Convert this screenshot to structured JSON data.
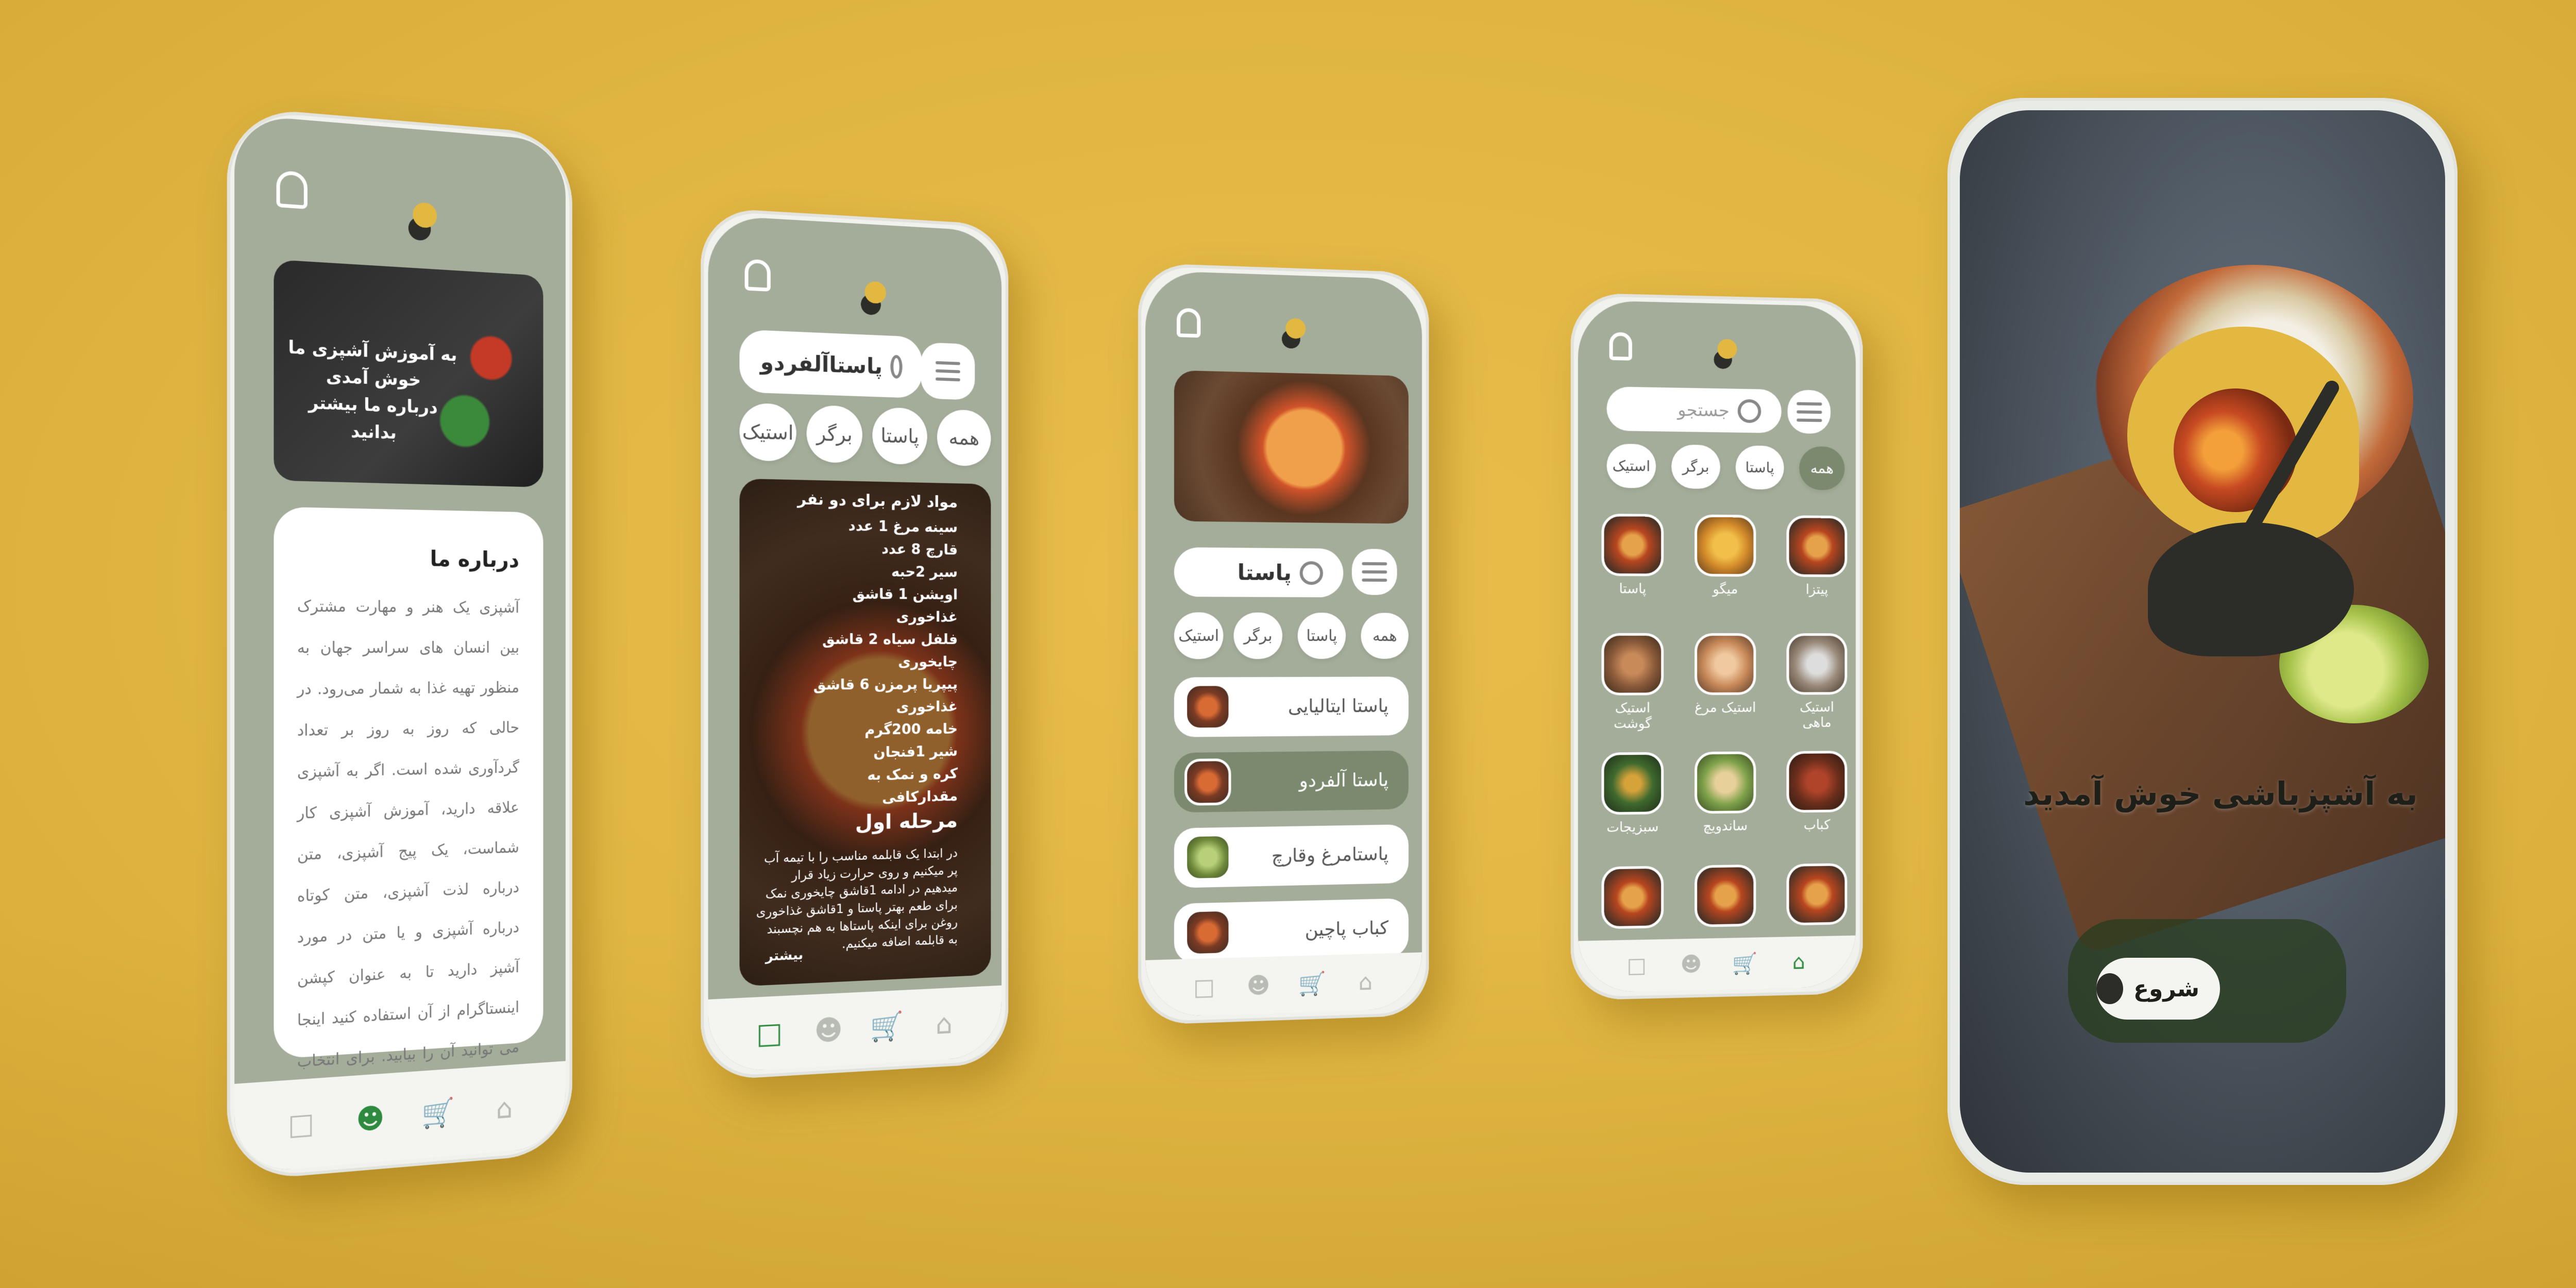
{
  "brand": {
    "yellow": "#e2b841",
    "sage": "#a4ad9a",
    "green_active": "#2d8a3e",
    "dark": "#2c2c28"
  },
  "phone_about": {
    "banner_text": "به آموزش آشپزی ما خوش آمدی\nدرباره ما بیشتر بدانید",
    "about_title": "درباره ما",
    "about_body": "آشپزی یک هنر و مهارت مشترک بین انسان های سراسر جهان به منظور تهیه غذا به شمار می‌رود. در حالی که روز به روز بر تعداد گردآوری شده است. اگر به آشپزی علاقه دارید، آموزش آشپزی کار شماست، یک پیج آشپزی، متن درباره لذت آشپزی، متن کوتاه درباره آشپزی و یا متن در مورد آشپز دارید تا به عنوان کپشن اینستاگرام از آن استفاده کنید اینجا می توانید آن را بیابید. برای انتخاب اسم برای پیج آشپزی کلیک کنید.",
    "nav_icons": [
      "bookmark-icon",
      "people-icon",
      "cart-icon",
      "home-icon"
    ],
    "active_nav": 1
  },
  "phone_recipe": {
    "search_value": "پاستاآلفردو",
    "filters": [
      "همه",
      "پاستا",
      "برگر",
      "استیک"
    ],
    "ingredients_title": "مواد لازم برای دو نفر",
    "ingredients": [
      "سینه مرغ 1 عدد",
      "قارچ 8 عدد",
      "سیر 2حبه",
      "اویشن 1 قاشق",
      "غذاخوری",
      "فلفل سیاه 2 قاشق",
      "چایخوری",
      "پیپریا پرمزن 6 قاشق",
      "غذاخوری",
      "خامه 200گرم",
      "شیر 1فنجان",
      "کره و نمک به مقدارکافی"
    ],
    "step_title": "مرحله اول",
    "step_body": "در ابتدا یک قابلمه مناسب را با تیمه آب پر میکنیم و روی حرارت زیاد قرار میدهیم در ادامه 1قاشق چایخوری نمک برای طعم بهتر پاستا و 1قاشق غذاخوری روغن برای اینکه پاستاها به هم نچسبند به قابلمه اضافه میکنیم.",
    "more_label": "بیشتر",
    "active_nav": 0
  },
  "phone_list": {
    "search_value": "پاستا",
    "filters": [
      "همه",
      "پاستا",
      "برگر",
      "استیک"
    ],
    "rows": [
      {
        "label": "پاستا ایتالیایی",
        "active": false
      },
      {
        "label": "پاستا آلفردو",
        "active": true
      },
      {
        "label": "پاستامرغ وقارچ",
        "active": false
      },
      {
        "label": "کباب پاچین",
        "active": false
      }
    ],
    "active_nav": 2
  },
  "phone_grid": {
    "search_placeholder": "جستجو",
    "filters": [
      "همه",
      "پاستا",
      "برگر",
      "استیک"
    ],
    "active_filter": 0,
    "items": [
      "پیتزا",
      "میگو",
      "پاستا",
      "استیک ماهی",
      "استیک مرغ",
      "استیک گوشت",
      "کباب",
      "ساندویچ",
      "سبزیجات",
      "",
      "",
      ""
    ],
    "active_nav": 3
  },
  "phone_welcome": {
    "title": "به آشپزباشی خوش آمدید",
    "start_label": "شروع"
  }
}
